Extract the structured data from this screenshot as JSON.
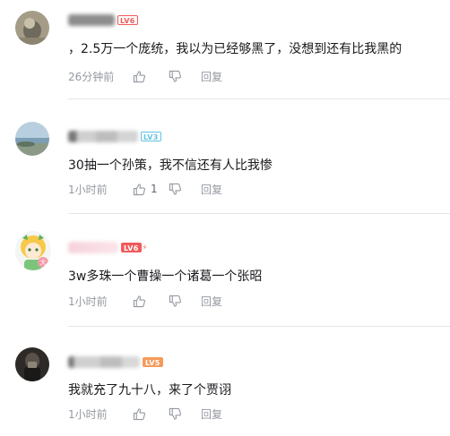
{
  "colors": {
    "text": "#18191c",
    "meta": "#9499a0",
    "divider": "#e3e5e7",
    "level_red": "#f05a5a",
    "level_blue": "#5fc3e4"
  },
  "comments": [
    {
      "level": "LV6",
      "text": "，2.5万一个庞统，我以为已经够黑了，没想到还有比我黑的",
      "time": "26分钟前",
      "likes": "",
      "reply_label": "回复",
      "like_icon": "thumbs-up-icon",
      "dislike_icon": "thumbs-down-icon"
    },
    {
      "level": "LV3",
      "text": "30抽一个孙策，我不信还有人比我惨",
      "time": "1小时前",
      "likes": "1",
      "reply_label": "回复",
      "like_icon": "thumbs-up-icon",
      "dislike_icon": "thumbs-down-icon"
    },
    {
      "level": "LV6",
      "text": "3w多珠一个曹操一个诸葛一个张昭",
      "time": "1小时前",
      "likes": "",
      "reply_label": "回复",
      "like_icon": "thumbs-up-icon",
      "dislike_icon": "thumbs-down-icon"
    },
    {
      "level": "LV5",
      "text": "我就充了九十八，来了个贾诩",
      "time": "1小时前",
      "likes": "",
      "reply_label": "回复",
      "like_icon": "thumbs-up-icon",
      "dislike_icon": "thumbs-down-icon"
    }
  ]
}
